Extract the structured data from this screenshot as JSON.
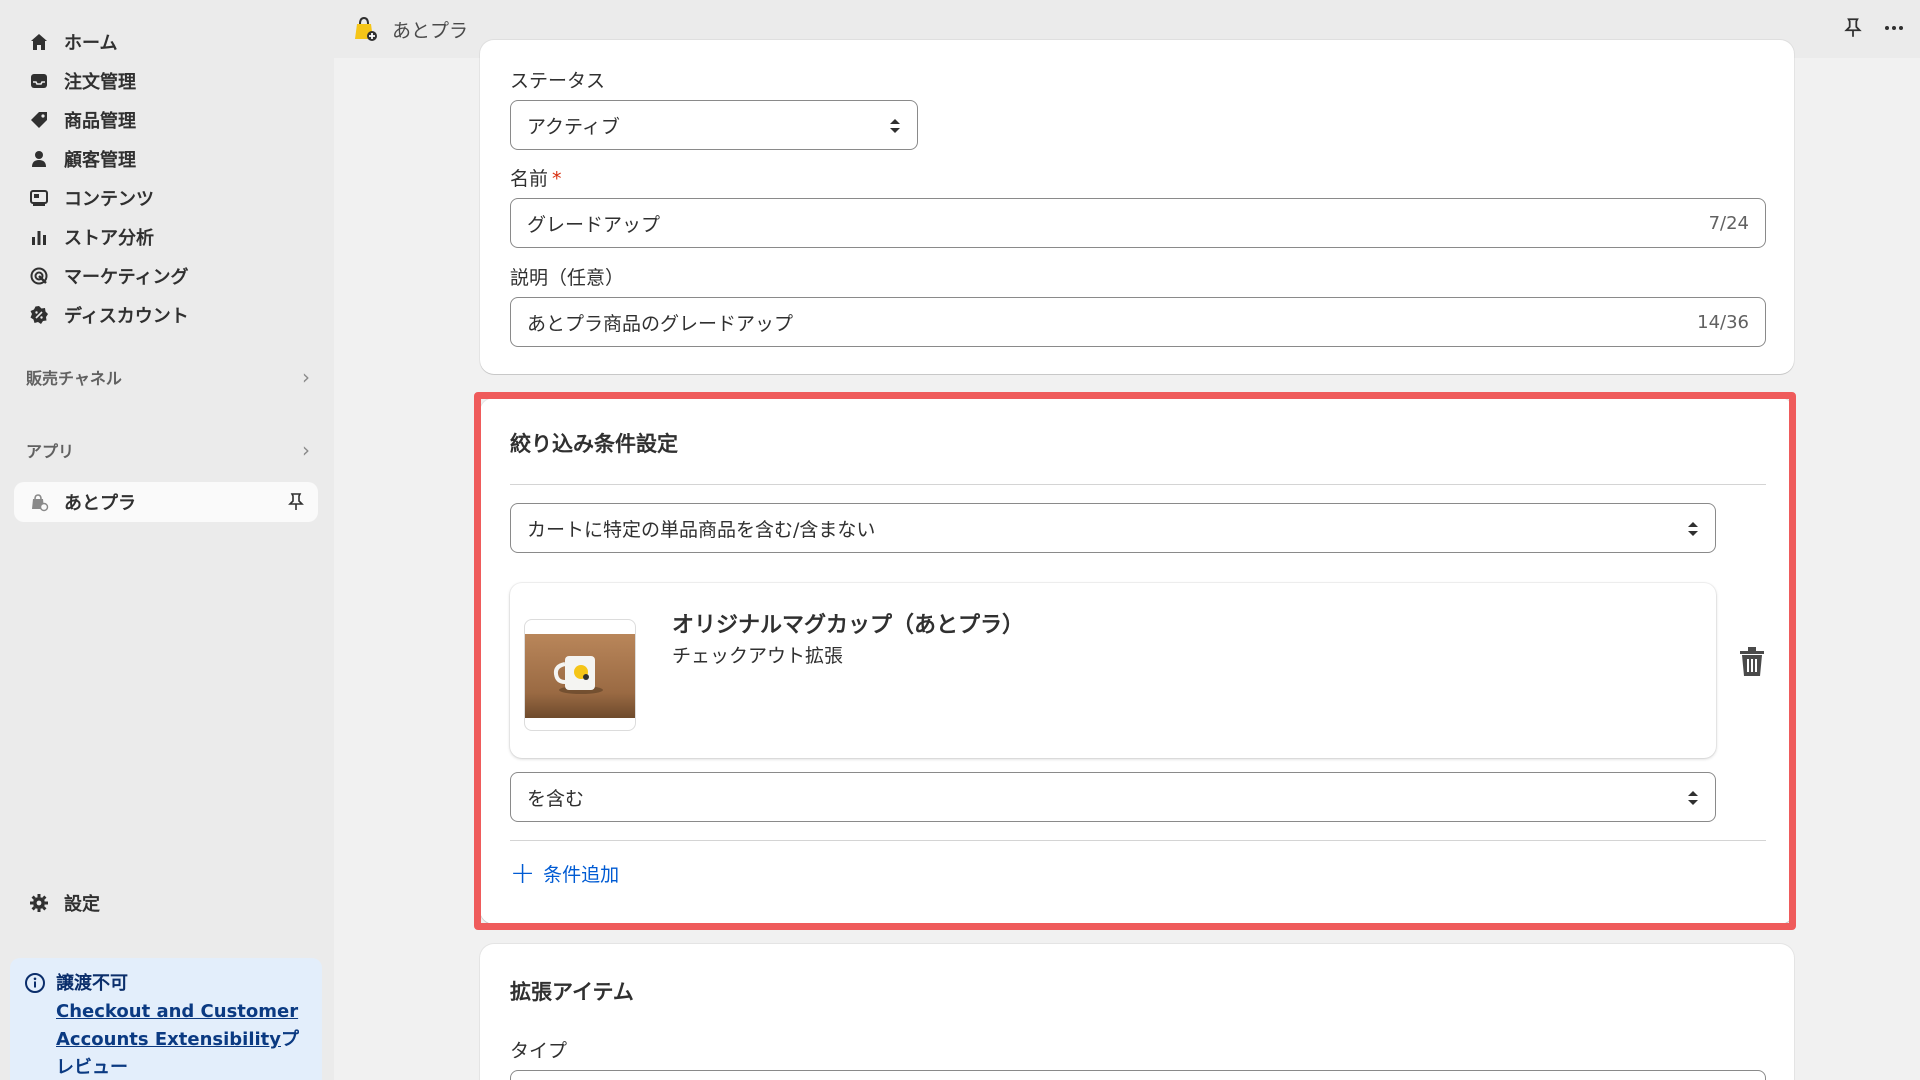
{
  "sidebar": {
    "items": [
      {
        "label": "ホーム",
        "icon": "home-icon"
      },
      {
        "label": "注文管理",
        "icon": "inbox-icon"
      },
      {
        "label": "商品管理",
        "icon": "tag-icon"
      },
      {
        "label": "顧客管理",
        "icon": "person-icon"
      },
      {
        "label": "コンテンツ",
        "icon": "content-icon"
      },
      {
        "label": "ストア分析",
        "icon": "bar-chart-icon"
      },
      {
        "label": "マーケティング",
        "icon": "target-icon"
      },
      {
        "label": "ディスカウント",
        "icon": "discount-icon"
      }
    ],
    "sales_channels": "販売チャネル",
    "apps": "アプリ",
    "active_app": "あとプラ",
    "settings": "設定",
    "notice": {
      "title": "譲渡不可",
      "link": "Checkout and Customer Accounts Extensibility",
      "suffix": "プレビュー"
    }
  },
  "topbar": {
    "app_name": "あとプラ"
  },
  "form": {
    "status_label": "ステータス",
    "status_value": "アクティブ",
    "name_label": "名前",
    "name_required": "*",
    "name_value": "グレードアップ",
    "name_counter": "7/24",
    "desc_label": "説明（任意）",
    "desc_value": "あとプラ商品のグレードアップ",
    "desc_counter": "14/36"
  },
  "filter": {
    "title": "絞り込み条件設定",
    "condition_type": "カートに特定の単品商品を含む/含まない",
    "product_name": "オリジナルマグカップ（あとプラ）",
    "product_sub": "チェックアウト拡張",
    "include_value": "を含む",
    "add_condition": "条件追加"
  },
  "extension": {
    "title": "拡張アイテム",
    "type_label": "タイプ"
  },
  "colors": {
    "highlight": "#ef5b5b",
    "link": "#005bd3",
    "notice_bg": "#e3eefb"
  }
}
